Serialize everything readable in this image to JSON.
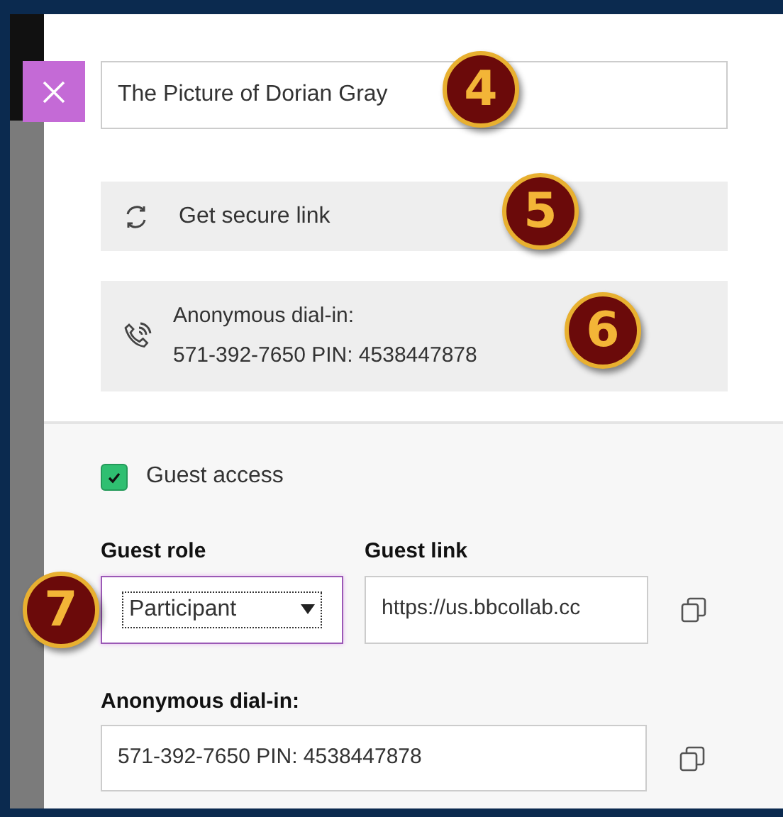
{
  "title_field": {
    "value": "The Picture of Dorian Gray"
  },
  "secure_link_button": {
    "label": "Get secure link"
  },
  "dial_in_info": {
    "label": "Anonymous dial-in:",
    "value": "571-392-7650 PIN: 4538447878"
  },
  "guest_access": {
    "label": "Guest access",
    "checked": true
  },
  "guest_role": {
    "label": "Guest role",
    "value": "Participant"
  },
  "guest_link": {
    "label": "Guest link",
    "value": "https://us.bbcollab.cc"
  },
  "anonymous_dial_in": {
    "label": "Anonymous dial-in:",
    "value": "571-392-7650 PIN: 4538447878"
  },
  "callouts": [
    "4",
    "5",
    "6",
    "7"
  ]
}
